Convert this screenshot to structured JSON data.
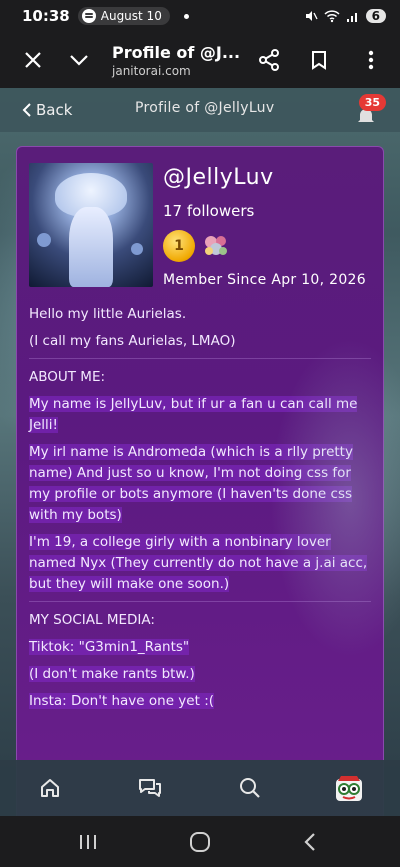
{
  "status_bar": {
    "time": "10:38",
    "media_date": "August 10",
    "battery": "6"
  },
  "browser": {
    "title": "Profile of @J...",
    "url": "janitorai.com"
  },
  "site_header": {
    "back_label": "Back",
    "title": "Profile of @JellyLuv",
    "notification_count": "35"
  },
  "profile": {
    "handle": "@JellyLuv",
    "followers": "17 followers",
    "member_since": "Member Since Apr 10, 2026",
    "badge_icons": [
      "gold-medal-icon",
      "flower-badge-icon"
    ]
  },
  "bio": {
    "greeting": "Hello my little Aurielas.",
    "fans_note": "(I call my fans Aurielas, LMAO)",
    "about_header": "ABOUT ME:",
    "about_1": "My name is JellyLuv, but if ur a fan u can call me Jelli!",
    "about_2": "My irl name is Andromeda (which is a rlly pretty name) And just so u know, I'm not doing css for my profile or bots anymore (I haven'ts done css with my bots)",
    "about_3": "I'm 19, a college girly with a nonbinary lover named Nyx (They currently do not have a j.ai acc, but they will make one soon.)",
    "social_header": "MY SOCIAL MEDIA:",
    "tiktok": "Tiktok: \"G3min1_Rants\"",
    "tiktok_note": "(I don't make rants btw.)",
    "insta": "Insta: Don't have one yet :("
  },
  "bottom_nav": {
    "items": [
      "home-icon",
      "chat-icon",
      "search-icon",
      "user-avatar"
    ]
  },
  "colors": {
    "card_bg": "#5b1a80",
    "highlight": "#8228c8",
    "badge_red": "#e53935"
  }
}
